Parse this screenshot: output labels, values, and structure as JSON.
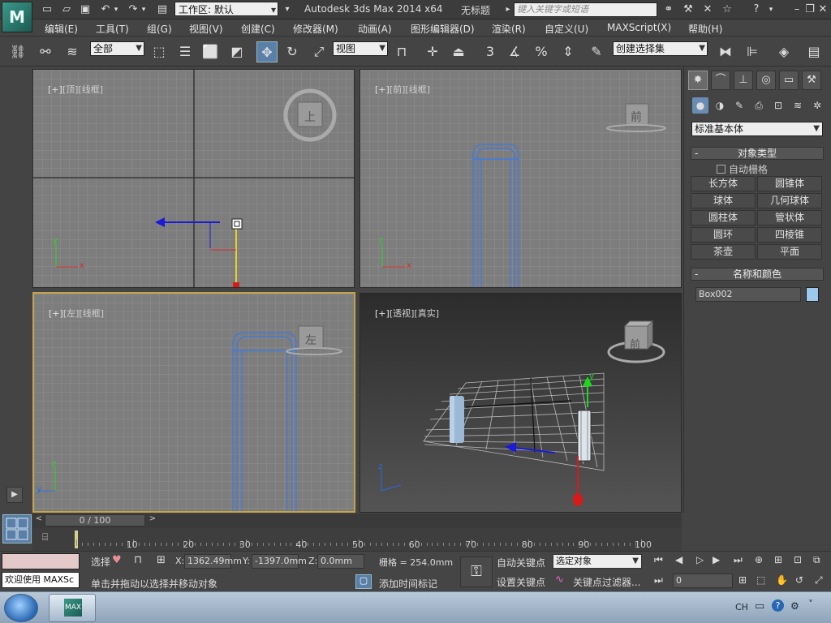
{
  "title_bar": {
    "logo_text": "M",
    "workspace_value": "工作区: 默认",
    "app_title": "Autodesk 3ds Max  2014 x64",
    "doc_title": "无标题",
    "search_placeholder": "键入关键字或短语",
    "help_icon": "?"
  },
  "menu": {
    "items": [
      "编辑(E)",
      "工具(T)",
      "组(G)",
      "视图(V)",
      "创建(C)",
      "修改器(M)",
      "动画(A)",
      "图形编辑器(D)",
      "渲染(R)",
      "自定义(U)",
      "MAXScript(X)",
      "帮助(H)"
    ]
  },
  "toolbar": {
    "selection_filter": "全部",
    "ref_coord": "视图",
    "named_selection": "创建选择集",
    "snap_num": "3",
    "percent": "%"
  },
  "viewports": {
    "top": {
      "b1": "[+]",
      "b2": "[顶]",
      "b3": "[线框]",
      "cube_label": "上"
    },
    "front": {
      "b1": "[+]",
      "b2": "[前]",
      "b3": "[线框]",
      "cube_label": "前"
    },
    "left": {
      "b1": "[+]",
      "b2": "[左]",
      "b3": "[线框]",
      "cube_label": "左"
    },
    "persp": {
      "b1": "[+]",
      "b2": "[透视]",
      "b3": "[真实]",
      "cube_label": "前"
    },
    "axis_x": "x",
    "axis_y": "y",
    "axis_z": "z"
  },
  "command_panel": {
    "category": "标准基本体",
    "object_type_title": "对象类型",
    "auto_grid": "自动栅格",
    "objects": [
      "长方体",
      "圆锥体",
      "球体",
      "几何球体",
      "圆柱体",
      "管状体",
      "圆环",
      "四棱锥",
      "茶壶",
      "平面"
    ],
    "name_color_title": "名称和颜色",
    "object_name": "Box002",
    "swatch_color": "#9cc8ec"
  },
  "timeline": {
    "frame_display": "0 / 100",
    "ticks": [
      "0",
      "10",
      "20",
      "30",
      "40",
      "50",
      "60",
      "70",
      "80",
      "90",
      "100"
    ]
  },
  "status_bar": {
    "maxscript_text": "欢迎使用 MAXSc",
    "selection_label": "选择",
    "x_label": "X:",
    "x_value": "1362.49mm",
    "y_label": "Y:",
    "y_value": "-1397.0mm",
    "z_label": "Z:",
    "z_value": "0.0mm",
    "grid_value": "栅格 = 254.0mm",
    "prompt": "单击并拖动以选择并移动对象",
    "add_time_tag": "添加时间标记",
    "auto_key": "自动关键点",
    "set_key": "设置关键点",
    "key_target": "选定对象",
    "key_filters": "关键点过滤器...",
    "current_frame": "0"
  },
  "taskbar": {
    "app_label": "MAX",
    "lang": "CH"
  }
}
